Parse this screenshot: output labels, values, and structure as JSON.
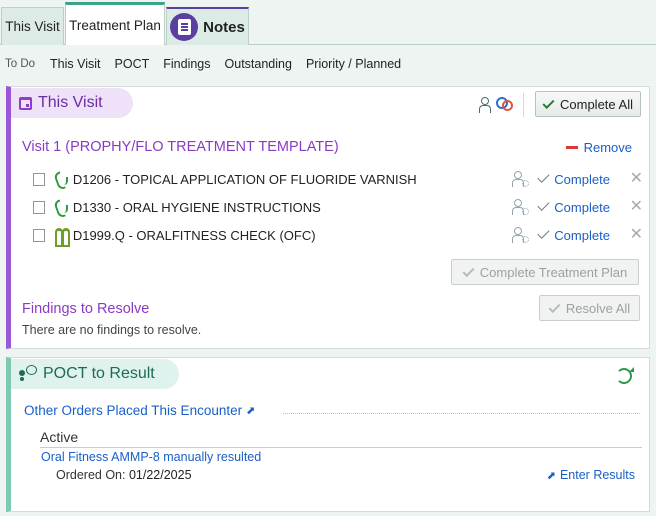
{
  "tabs": {
    "this_visit": "This Visit",
    "treatment_plan": "Treatment Plan",
    "notes": "Notes"
  },
  "subnav": {
    "todo": "To Do",
    "items": [
      "This Visit",
      "POCT",
      "Findings",
      "Outstanding",
      "Priority / Planned"
    ]
  },
  "this_visit": {
    "title": "This Visit",
    "complete_all": "Complete All",
    "visit_title": "Visit 1 (PROPHY/FLO TREATMENT TEMPLATE)",
    "remove": "Remove",
    "procedures": [
      {
        "text": "D1206 - TOPICAL APPLICATION OF FLUORIDE VARNISH",
        "action": "Complete"
      },
      {
        "text": "D1330 - ORAL HYGIENE INSTRUCTIONS",
        "action": "Complete"
      },
      {
        "text": "D1999.Q - ORALFITNESS CHECK (OFC)",
        "action": "Complete"
      }
    ],
    "complete_treatment_plan": "Complete Treatment Plan",
    "findings_title": "Findings to Resolve",
    "resolve_all": "Resolve All",
    "findings_empty": "There are no findings to resolve."
  },
  "poct": {
    "title": "POCT to Result",
    "orders_title": "Other Orders Placed This Encounter",
    "active_label": "Active",
    "order_name": "Oral Fitness AMMP-8 manually resulted",
    "ordered_on_label": "Ordered On:",
    "ordered_on_value": "01/22/2025",
    "enter_results": "Enter Results"
  },
  "colors": {
    "accent_visit": "#9b57d8",
    "accent_poct": "#7ec9b3",
    "link": "#1a5fc9"
  }
}
